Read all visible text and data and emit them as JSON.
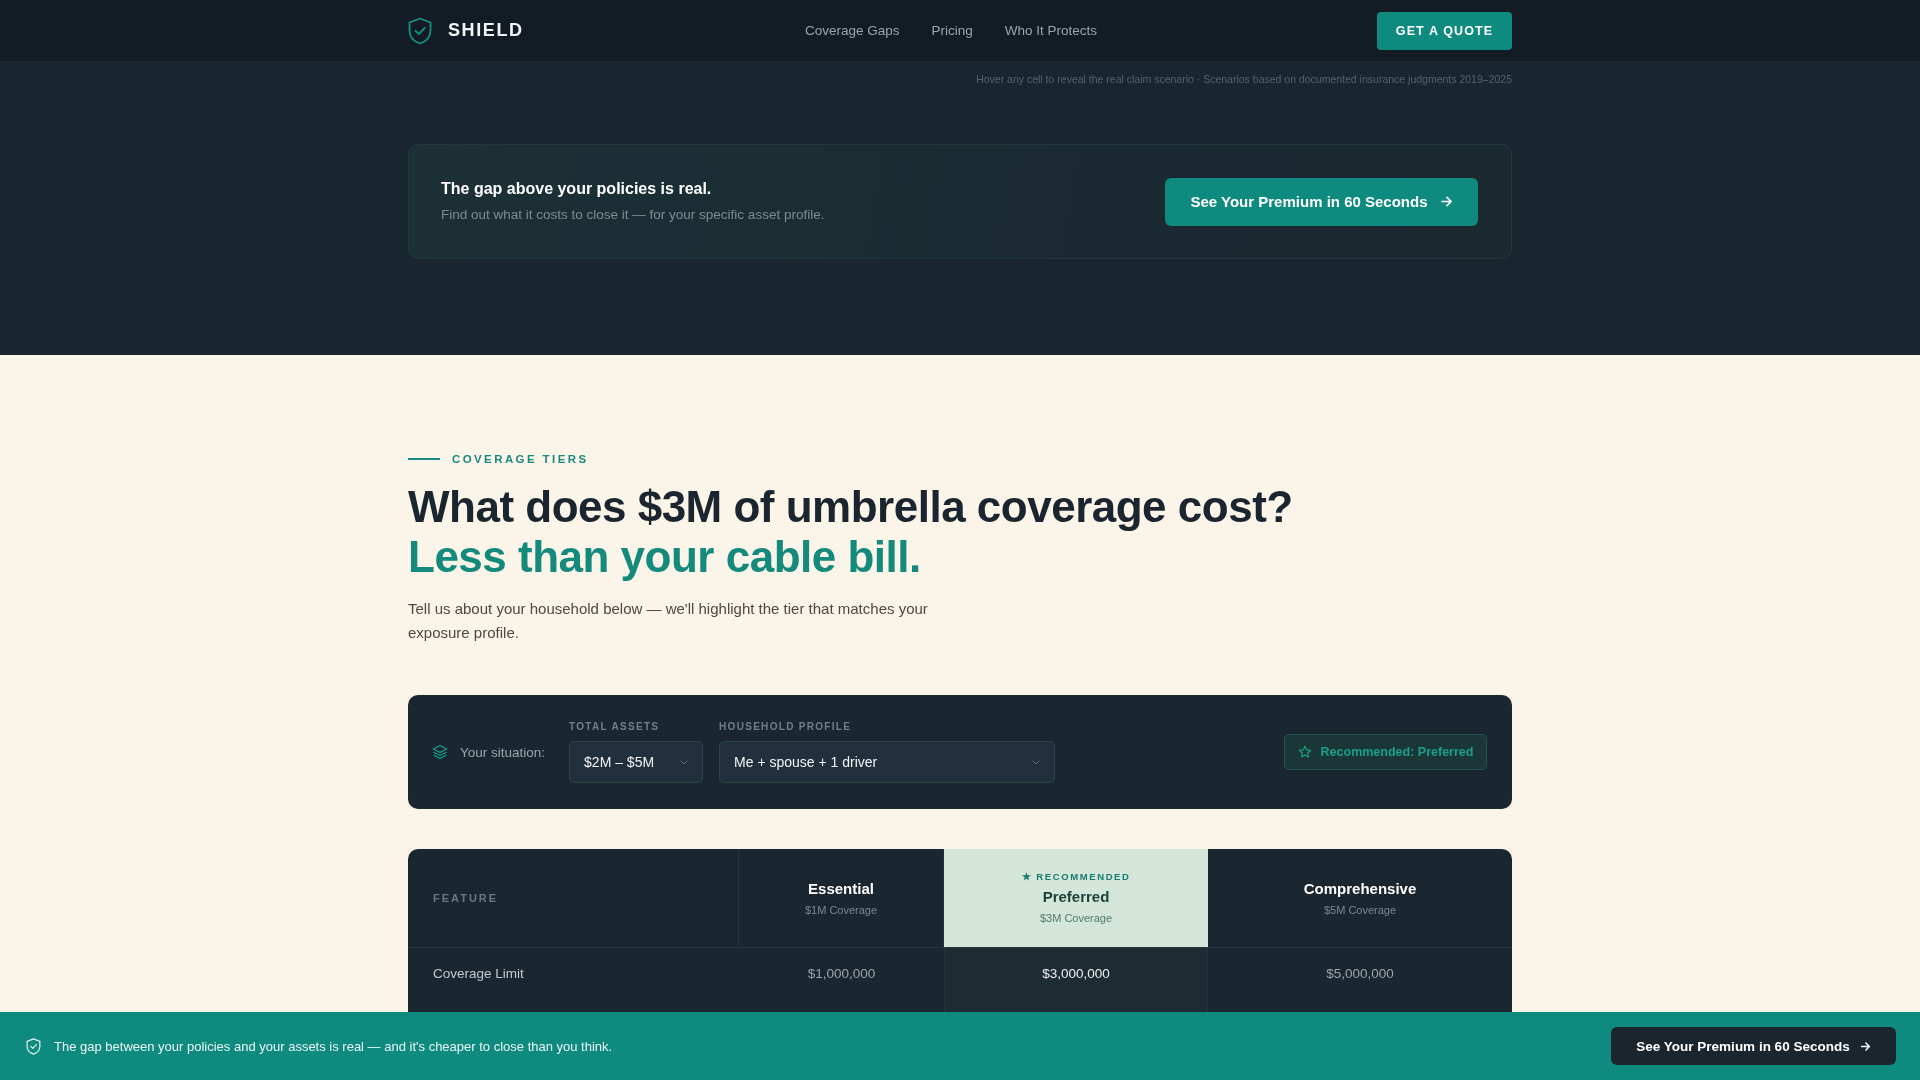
{
  "nav": {
    "brand": "SHIELD",
    "links": [
      "Coverage Gaps",
      "Pricing",
      "Who It Protects"
    ],
    "cta": "GET A QUOTE"
  },
  "hero": {
    "hint": "Hover any cell to reveal the real claim scenario · Scenarios based on documented insurance judgments 2019–2025",
    "banner": {
      "title": "The gap above your policies is real.",
      "subtitle": "Find out what it costs to close it — for your specific asset profile.",
      "button": "See Your Premium in 60 Seconds"
    }
  },
  "tiers_section": {
    "eyebrow": "COVERAGE TIERS",
    "title": "What does $3M of umbrella coverage cost?",
    "title_accent": "Less than your cable bill.",
    "intro": "Tell us about your household below — we'll highlight the tier that matches your exposure profile."
  },
  "situation": {
    "label": "Your situation:",
    "fields": [
      {
        "label": "TOTAL ASSETS",
        "value": "$2M – $5M"
      },
      {
        "label": "HOUSEHOLD PROFILE",
        "value": "Me + spouse + 1 driver"
      }
    ],
    "recommendation": "Recommended: Preferred"
  },
  "table": {
    "feature_heading": "FEATURE",
    "tiers": [
      {
        "name": "Essential",
        "coverage": "$1M Coverage",
        "recommended": false
      },
      {
        "name": "Preferred",
        "coverage": "$3M Coverage",
        "recommended": true,
        "badge": "★ RECOMMENDED"
      },
      {
        "name": "Comprehensive",
        "coverage": "$5M Coverage",
        "recommended": false
      }
    ],
    "rows": [
      {
        "feature": "Coverage Limit",
        "values": [
          "$1,000,000",
          "$3,000,000",
          "$5,000,000"
        ]
      }
    ]
  },
  "sticky_bar": {
    "message": "The gap between your policies and your assets is real — and it's cheaper to close than you think.",
    "button": "See Your Premium in 60 Seconds"
  }
}
